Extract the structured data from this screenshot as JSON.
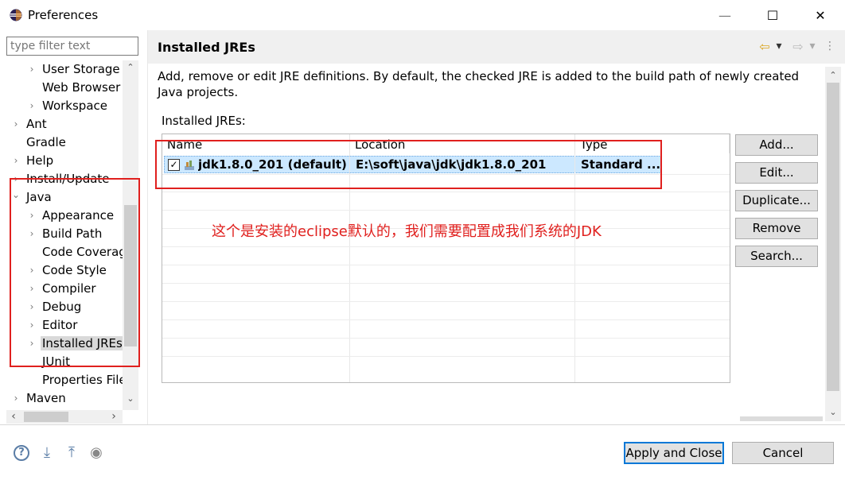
{
  "window": {
    "title": "Preferences",
    "minimize": "—",
    "maximize": "☐",
    "close": "✕"
  },
  "filter": {
    "placeholder": "type filter text",
    "value": ""
  },
  "tree": {
    "items": [
      {
        "label": "User Storage",
        "chevron": "›"
      },
      {
        "label": "Web Browser",
        "chevron": ""
      },
      {
        "label": "Workspace",
        "chevron": "›"
      },
      {
        "label": "Ant",
        "chevron": "›"
      },
      {
        "label": "Gradle",
        "chevron": ""
      },
      {
        "label": "Help",
        "chevron": "›"
      },
      {
        "label": "Install/Update",
        "chevron": "›"
      },
      {
        "label": "Java",
        "chevron": "⌄"
      },
      {
        "label": "Appearance",
        "chevron": "›"
      },
      {
        "label": "Build Path",
        "chevron": "›"
      },
      {
        "label": "Code Coverag",
        "chevron": ""
      },
      {
        "label": "Code Style",
        "chevron": "›"
      },
      {
        "label": "Compiler",
        "chevron": "›"
      },
      {
        "label": "Debug",
        "chevron": "›"
      },
      {
        "label": "Editor",
        "chevron": "›"
      },
      {
        "label": "Installed JREs",
        "chevron": "›"
      },
      {
        "label": "JUnit",
        "chevron": ""
      },
      {
        "label": "Properties File",
        "chevron": ""
      },
      {
        "label": "Maven",
        "chevron": "›"
      }
    ],
    "scroll_up": "⌃",
    "scroll_down": "⌄",
    "scroll_left": "‹",
    "scroll_right": "›"
  },
  "page": {
    "title": "Installed JREs",
    "nav_back": "⇦",
    "nav_back_menu": "▾",
    "nav_forward": "⇨",
    "nav_forward_menu": "▾",
    "more": "⋮",
    "description": "Add, remove or edit JRE definitions. By default, the checked JRE is added to the build path of newly created Java projects.",
    "jres_label": "Installed JREs:",
    "columns": [
      "Name",
      "Location",
      "Type"
    ],
    "rows": [
      {
        "checked": "✓",
        "name": "jdk1.8.0_201 (default)",
        "location": "E:\\soft\\java\\jdk\\jdk1.8.0_201",
        "type": "Standard ..."
      }
    ],
    "buttons": {
      "add": "Add...",
      "edit": "Edit...",
      "duplicate": "Duplicate...",
      "remove": "Remove",
      "search": "Search..."
    },
    "annotation": "这个是安装的eclipse默认的，我们需要配置成我们系统的JDK"
  },
  "footer": {
    "help_icon": "?",
    "import_icon": "⤓",
    "export_icon": "⤒",
    "record_icon": "◉",
    "apply_close": "Apply and Close",
    "cancel": "Cancel"
  },
  "colors": {
    "annotation_red": "#e0201e",
    "selection_blue": "#cce8ff",
    "default_button_border": "#0078d7"
  }
}
